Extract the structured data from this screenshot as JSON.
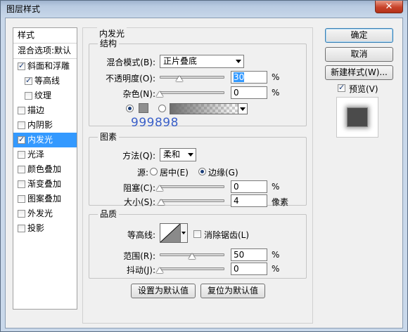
{
  "window": {
    "title": "图层样式",
    "close_glyph": "✕"
  },
  "left_list": {
    "header": "样式",
    "blend_options": "混合选项:默认",
    "items": [
      {
        "label": "斜面和浮雕",
        "checked": true,
        "indent": false
      },
      {
        "label": "等高线",
        "checked": true,
        "indent": true
      },
      {
        "label": "纹理",
        "checked": false,
        "indent": true
      },
      {
        "label": "描边",
        "checked": false,
        "indent": false
      },
      {
        "label": "内阴影",
        "checked": false,
        "indent": false
      },
      {
        "label": "内发光",
        "checked": true,
        "indent": false,
        "selected": true
      },
      {
        "label": "光泽",
        "checked": false,
        "indent": false
      },
      {
        "label": "颜色叠加",
        "checked": false,
        "indent": false
      },
      {
        "label": "渐变叠加",
        "checked": false,
        "indent": false
      },
      {
        "label": "图案叠加",
        "checked": false,
        "indent": false
      },
      {
        "label": "外发光",
        "checked": false,
        "indent": false
      },
      {
        "label": "投影",
        "checked": false,
        "indent": false
      }
    ]
  },
  "panel": {
    "title": "内发光",
    "structure": {
      "title": "结构",
      "blend_mode_label": "混合模式(B):",
      "blend_mode_value": "正片叠底",
      "opacity_label": "不透明度(O):",
      "opacity_value": "30",
      "opacity_unit": "%",
      "opacity_level": 0.3,
      "noise_label": "杂色(N):",
      "noise_value": "0",
      "noise_unit": "%",
      "noise_level": 0,
      "color_mode": "solid",
      "swatch_color": "#8f8f8f"
    },
    "watermark": "999898",
    "elements": {
      "title": "图素",
      "method_label": "方法(Q):",
      "method_value": "柔和",
      "source_label": "源:",
      "source_center": "居中(E)",
      "source_edge": "边缘(G)",
      "source_selected": "edge",
      "choke_label": "阻塞(C):",
      "choke_value": "0",
      "choke_unit": "%",
      "choke_level": 0,
      "size_label": "大小(S):",
      "size_value": "4",
      "size_unit": "像素",
      "size_level": 0.02
    },
    "quality": {
      "title": "品质",
      "contour_label": "等高线:",
      "antialias_label": "消除锯齿(L)",
      "antialias_checked": false,
      "range_label": "范围(R):",
      "range_value": "50",
      "range_unit": "%",
      "range_level": 0.5,
      "jitter_label": "抖动(J):",
      "jitter_value": "0",
      "jitter_unit": "%",
      "jitter_level": 0
    },
    "set_default": "设置为默认值",
    "reset_default": "复位为默认值"
  },
  "buttons": {
    "ok": "确定",
    "cancel": "取消",
    "new_style": "新建样式(W)...",
    "preview_label": "预览(V)",
    "preview_checked": true
  }
}
